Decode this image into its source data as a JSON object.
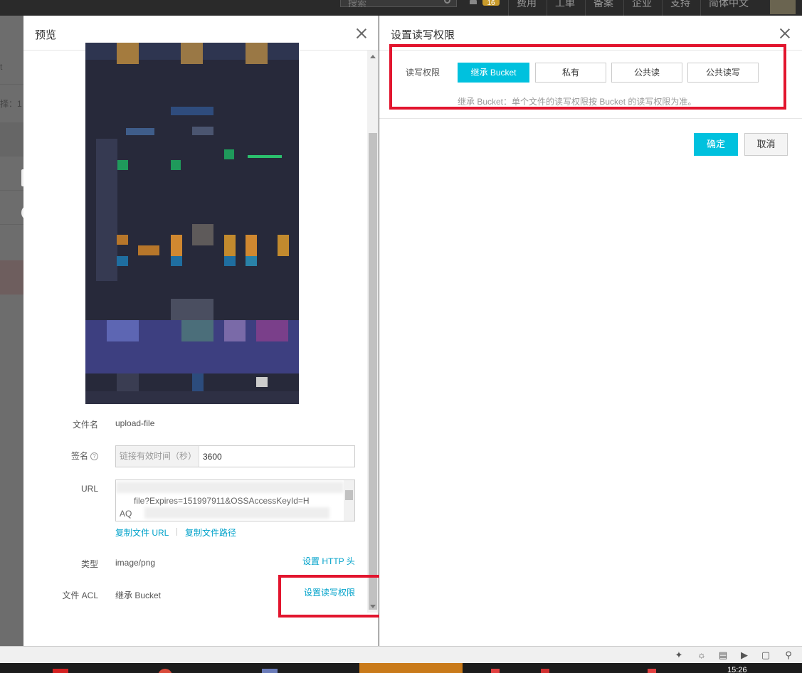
{
  "topnav": {
    "search_placeholder": "搜索",
    "badge_count": "16",
    "items": [
      "费用",
      "工单",
      "备案",
      "企业",
      "支持",
      "简体中文"
    ]
  },
  "bgpage": {
    "row_texts": [
      "t",
      "择：1"
    ]
  },
  "preview": {
    "title": "预览",
    "fields": {
      "filename_label": "文件名",
      "filename_value": "upload-file",
      "signature_label": "签名",
      "signature_help": "?",
      "signature_addon": "链接有效时间（秒）",
      "signature_value": "3600",
      "url_label": "URL",
      "url_line1": "file?Expires=151997911&OSSAccessKeyId=H",
      "url_line2": "AQ",
      "copy_url": "复制文件 URL",
      "copy_path": "复制文件路径",
      "type_label": "类型",
      "type_value": "image/png",
      "set_http_header": "设置 HTTP 头",
      "acl_label": "文件 ACL",
      "acl_value": "继承 Bucket",
      "set_acl": "设置读写权限"
    }
  },
  "acl_panel": {
    "title": "设置读写权限",
    "label": "读写权限",
    "options": [
      "继承 Bucket",
      "私有",
      "公共读",
      "公共读写"
    ],
    "selected": "继承 Bucket",
    "hint": "继承 Bucket：单个文件的读写权限按 Bucket 的读写权限为准。",
    "ok": "确定",
    "cancel": "取消"
  },
  "statusbar": {
    "icons": [
      "pin-icon",
      "browser-icon",
      "trash-icon",
      "speaker-icon",
      "window-icon",
      "search-icon"
    ]
  },
  "taskbar": {
    "clock": "15:26"
  },
  "colors": {
    "accent": "#00c1de",
    "link": "#00a2ca",
    "highlight": "#e2152e"
  }
}
